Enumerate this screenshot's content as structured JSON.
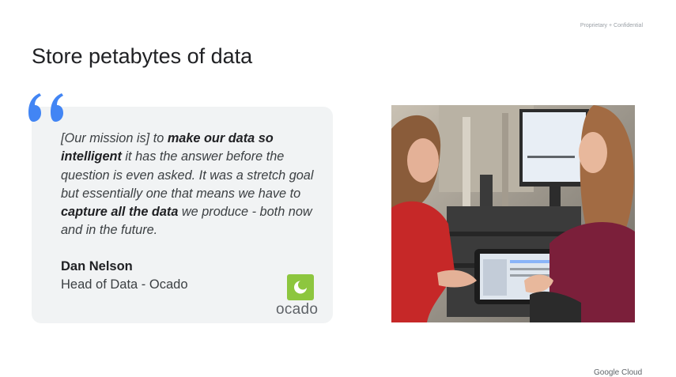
{
  "header": {
    "confidential": "Proprietary + Confidential",
    "title": "Store petabytes of data"
  },
  "quote": {
    "seg1": "[Our mission is] to ",
    "seg2": "make our data so intelligent",
    "seg3": " it has the answer before the question is even asked. It was a stretch goal but essentially one that means we have to ",
    "seg4": "capture all the data",
    "seg5": " we produce - both now and in the future.",
    "person_name": "Dan Nelson",
    "person_role": "Head of Data - Ocado",
    "logo_text": "ocado",
    "quote_icon": "quotation-mark-icon",
    "accent_color": "#4285f4",
    "logo_color": "#8dc63f"
  },
  "photo": {
    "alt_icon": "photo-two-workers-with-tablet"
  },
  "footer": {
    "brand": "Google Cloud"
  }
}
